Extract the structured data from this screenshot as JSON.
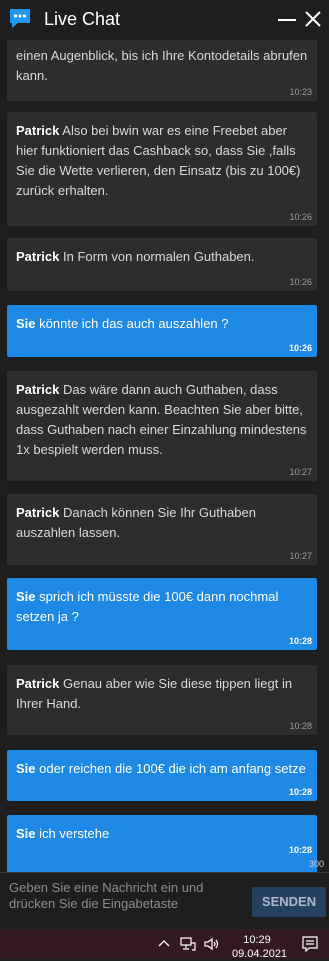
{
  "header": {
    "title": "Live Chat"
  },
  "messages": [
    {
      "type": "agent",
      "sender": "",
      "text": "einen Augenblick, bis ich Ihre Kontodetails abrufen kann.",
      "time": "10:23"
    },
    {
      "type": "agent",
      "sender": "Patrick",
      "text": "Also bei bwin war es eine Freebet aber hier funktioniert das Cashback so, dass Sie ,falls Sie die Wette verlieren, den Einsatz (bis zu 100€) zurück erhalten.",
      "time": "10:26"
    },
    {
      "type": "agent",
      "sender": "Patrick",
      "text": "In Form von normalen Guthaben.",
      "time": "10:26"
    },
    {
      "type": "user",
      "sender": "Sie",
      "text": "könnte ich das auch auszahlen ?",
      "time": "10:26"
    },
    {
      "type": "agent",
      "sender": "Patrick",
      "text": "Das wäre dann auch Guthaben, dass ausgezahlt werden kann. Beachten Sie aber bitte, dass Guthaben nach einer Einzahlung mindestens 1x bespielt werden muss.",
      "time": "10:27"
    },
    {
      "type": "agent",
      "sender": "Patrick",
      "text": "Danach können Sie Ihr Guthaben auszahlen lassen.",
      "time": "10:27"
    },
    {
      "type": "user",
      "sender": "Sie",
      "text": "sprich ich müsste die 100€ dann nochmal setzen ja ?",
      "time": "10:28"
    },
    {
      "type": "agent",
      "sender": "Patrick",
      "text": "Genau aber wie Sie diese tippen liegt in Ihrer Hand.",
      "time": "10:28"
    },
    {
      "type": "user",
      "sender": "Sie",
      "text": "oder reichen die 100€ die ich am anfang setze",
      "time": "10:28"
    },
    {
      "type": "user",
      "sender": "Sie",
      "text": "ich verstehe",
      "time": "10:28"
    }
  ],
  "composer": {
    "char_counter": "300",
    "placeholder": "Geben Sie eine Nachricht ein und drücken Sie die Eingabetaste",
    "send_label": "SENDEN"
  },
  "taskbar": {
    "time": "10:29",
    "date": "09.04.2021"
  },
  "colors": {
    "background": "#1e1e1e",
    "agent_bubble": "#2d2d2d",
    "user_bubble": "#1e88e5",
    "send_button": "#26415f",
    "taskbar": "#331a22"
  },
  "icons": {
    "header_logo": "chat-bubble-icon",
    "minimize": "minimize-icon",
    "close": "close-icon",
    "tray": [
      "chevron-up-icon",
      "network-icon",
      "speaker-icon",
      "notification-icon"
    ]
  }
}
